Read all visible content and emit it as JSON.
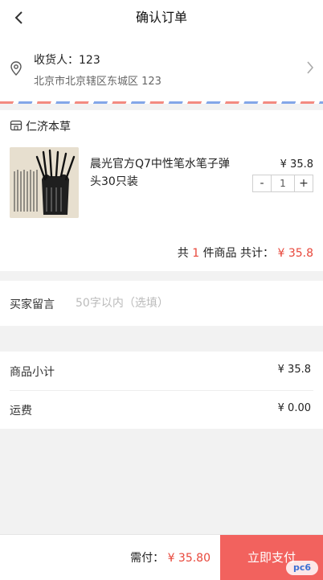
{
  "header": {
    "title": "确认订单",
    "back_icon": "chevron-left-icon"
  },
  "address": {
    "recipient": "收货人：123",
    "detail": "北京市北京辖区东城区 123",
    "pin_icon": "location-pin-icon",
    "arrow_icon": "chevron-right-icon"
  },
  "shop": {
    "name": "仁济本草",
    "icon": "store-icon",
    "item": {
      "title": "晨光官方Q7中性笔水笔子弹头30只装",
      "price": "¥ 35.8",
      "quantity": "1",
      "minus": "-",
      "plus": "+"
    },
    "summary": {
      "prefix": "共",
      "count": "1",
      "middle": "件商品 共计：",
      "total": "¥ 35.8"
    }
  },
  "message": {
    "label": "买家留言",
    "placeholder": "50字以内（选填）",
    "value": ""
  },
  "costs": [
    {
      "label": "商品小计",
      "value": "¥ 35.8"
    },
    {
      "label": "运费",
      "value": "¥ 0.00"
    }
  ],
  "bottom": {
    "due_label": "需付：",
    "due_value": "¥ 35.80",
    "pay_button": "立即支付"
  },
  "colors": {
    "accent": "#e8473b",
    "pay_button": "#f2625e"
  },
  "watermark": "pc6"
}
